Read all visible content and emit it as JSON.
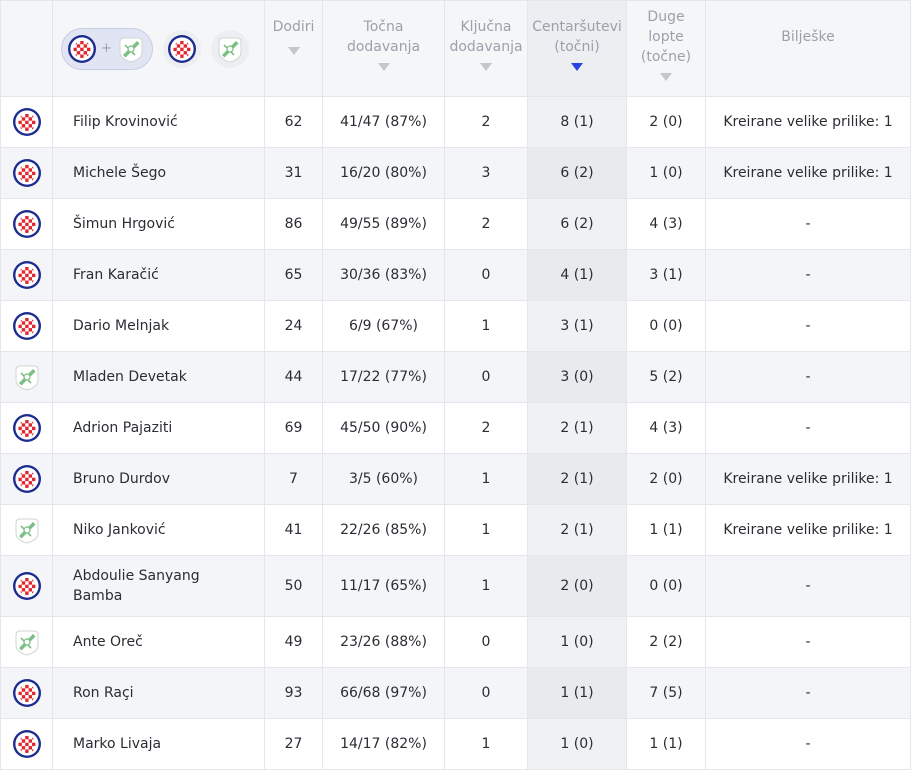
{
  "colors": {
    "accent": "#2a44e0",
    "hajduk_blue": "#1d2d8f",
    "hajduk_red": "#e3262d",
    "rijeka_green": "#7bbf83"
  },
  "filter": {
    "selected_label": "+",
    "options": [
      "hajduk-split-crest",
      "hnk-rijeka-crest"
    ]
  },
  "headers": {
    "touches": "Dodiri",
    "passes_line1": "Točna",
    "passes_line2": "dodavanja",
    "key_passes_line1": "Ključna",
    "key_passes_line2": "dodavanja",
    "crosses_line1": "Centaršutevi",
    "crosses_line2": "(točni)",
    "long_balls_line1": "Duge",
    "long_balls_line2": "lopte",
    "long_balls_line3": "(točne)",
    "notes": "Bilješke"
  },
  "sort": {
    "column": "crosses",
    "direction": "desc"
  },
  "rows": [
    {
      "team": "hajduk",
      "name": "Filip Krovinović",
      "touches": "62",
      "passes": "41/47 (87%)",
      "key_passes": "2",
      "crosses": "8 (1)",
      "long_balls": "2 (0)",
      "notes": "Kreirane velike prilike: 1"
    },
    {
      "team": "hajduk",
      "name": "Michele Šego",
      "touches": "31",
      "passes": "16/20 (80%)",
      "key_passes": "3",
      "crosses": "6 (2)",
      "long_balls": "1 (0)",
      "notes": "Kreirane velike prilike: 1"
    },
    {
      "team": "hajduk",
      "name": "Šimun Hrgović",
      "touches": "86",
      "passes": "49/55 (89%)",
      "key_passes": "2",
      "crosses": "6 (2)",
      "long_balls": "4 (3)",
      "notes": "-"
    },
    {
      "team": "hajduk",
      "name": "Fran Karačić",
      "touches": "65",
      "passes": "30/36 (83%)",
      "key_passes": "0",
      "crosses": "4 (1)",
      "long_balls": "3 (1)",
      "notes": "-"
    },
    {
      "team": "hajduk",
      "name": "Dario Melnjak",
      "touches": "24",
      "passes": "6/9 (67%)",
      "key_passes": "1",
      "crosses": "3 (1)",
      "long_balls": "0 (0)",
      "notes": "-"
    },
    {
      "team": "rijeka",
      "name": "Mladen Devetak",
      "touches": "44",
      "passes": "17/22 (77%)",
      "key_passes": "0",
      "crosses": "3 (0)",
      "long_balls": "5 (2)",
      "notes": "-"
    },
    {
      "team": "hajduk",
      "name": "Adrion Pajaziti",
      "touches": "69",
      "passes": "45/50 (90%)",
      "key_passes": "2",
      "crosses": "2 (1)",
      "long_balls": "4 (3)",
      "notes": "-"
    },
    {
      "team": "hajduk",
      "name": "Bruno Durdov",
      "touches": "7",
      "passes": "3/5 (60%)",
      "key_passes": "1",
      "crosses": "2 (1)",
      "long_balls": "2 (0)",
      "notes": "Kreirane velike prilike: 1"
    },
    {
      "team": "rijeka",
      "name": "Niko Janković",
      "touches": "41",
      "passes": "22/26 (85%)",
      "key_passes": "1",
      "crosses": "2 (1)",
      "long_balls": "1 (1)",
      "notes": "Kreirane velike prilike: 1"
    },
    {
      "team": "hajduk",
      "name_line1": "Abdoulie Sanyang",
      "name_line2": "Bamba",
      "touches": "50",
      "passes": "11/17 (65%)",
      "key_passes": "1",
      "crosses": "2 (0)",
      "long_balls": "0 (0)",
      "notes": "-"
    },
    {
      "team": "rijeka",
      "name": "Ante Oreč",
      "touches": "49",
      "passes": "23/26 (88%)",
      "key_passes": "0",
      "crosses": "1 (0)",
      "long_balls": "2 (2)",
      "notes": "-"
    },
    {
      "team": "hajduk",
      "name": "Ron Raçi",
      "touches": "93",
      "passes": "66/68 (97%)",
      "key_passes": "0",
      "crosses": "1 (1)",
      "long_balls": "7 (5)",
      "notes": "-"
    },
    {
      "team": "hajduk",
      "name": "Marko Livaja",
      "touches": "27",
      "passes": "14/17 (82%)",
      "key_passes": "1",
      "crosses": "1 (0)",
      "long_balls": "1 (1)",
      "notes": "-"
    }
  ]
}
